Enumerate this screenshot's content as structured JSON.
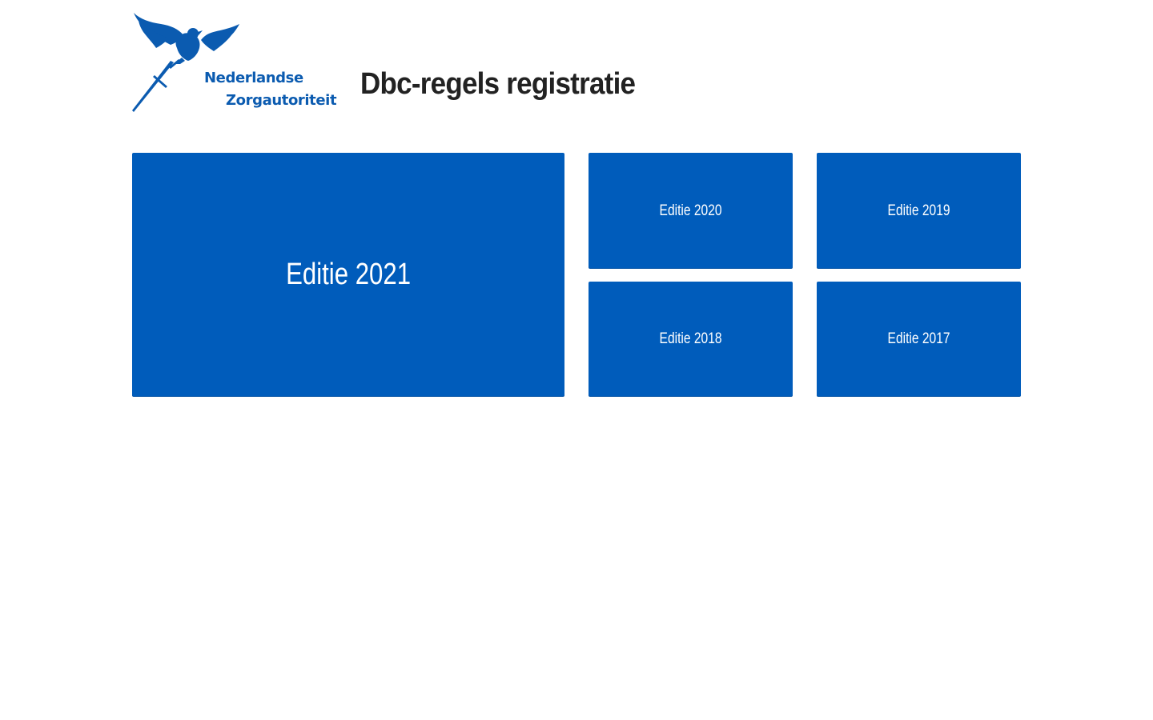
{
  "header": {
    "logo": {
      "line1": "Nederlandse",
      "line2": "Zorgautoriteit",
      "icon": "dove-with-sword-icon",
      "color": "#0b5bb0"
    },
    "title": "Dbc-regels registratie"
  },
  "editions": [
    {
      "label": "Editie 2021",
      "featured": true
    },
    {
      "label": "Editie 2020"
    },
    {
      "label": "Editie 2019"
    },
    {
      "label": "Editie 2018"
    },
    {
      "label": "Editie 2017"
    }
  ],
  "colors": {
    "tile": "#005cbb",
    "tile_text": "#ffffff",
    "title_text": "#222222"
  }
}
